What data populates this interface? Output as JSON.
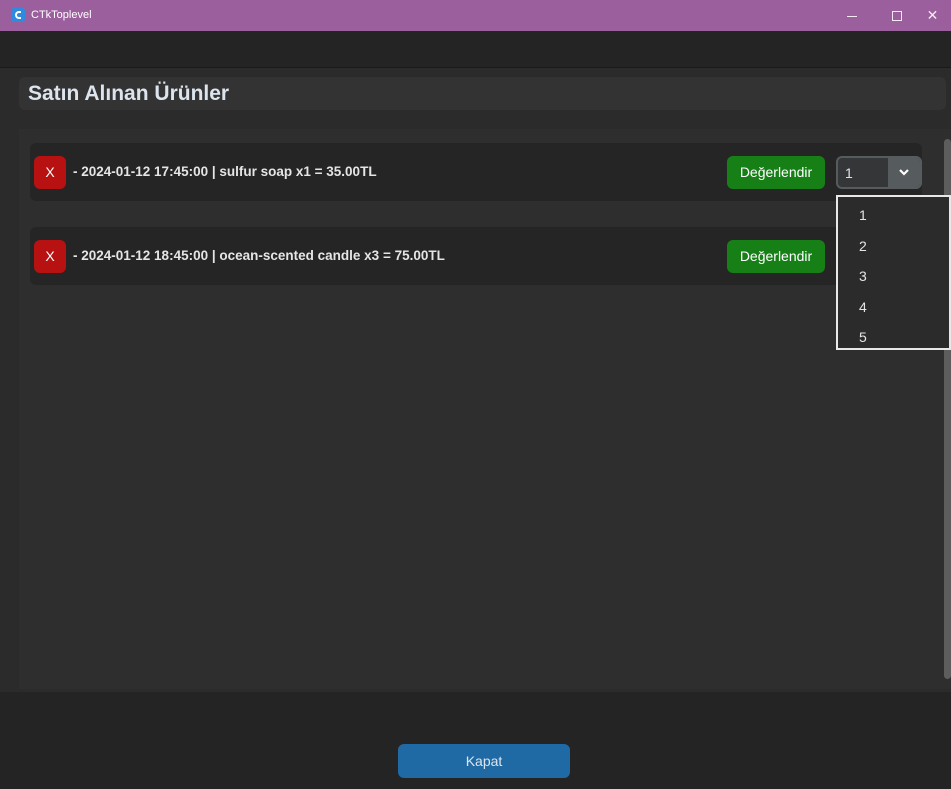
{
  "window": {
    "title": "CTkToplevel",
    "minimize_glyph": "minimize-icon",
    "maximize_glyph": "maximize-icon",
    "close_label": "✕"
  },
  "header": {
    "title": "Satın Alınan Ürünler"
  },
  "orders": [
    {
      "delete_label": "X",
      "text": "- 2024-01-12 17:45:00 | sulfur soap x1 = 35.00TL",
      "rate_label": "Değerlendir",
      "rating_value": "1"
    },
    {
      "delete_label": "X",
      "text": "- 2024-01-12 18:45:00 | ocean-scented candle x3 = 75.00TL",
      "rate_label": "Değerlendir"
    }
  ],
  "rating_options": [
    "1",
    "2",
    "3",
    "4",
    "5"
  ],
  "footer": {
    "close_label": "Kapat"
  },
  "colors": {
    "titlebar": "#9c5f9d",
    "delete": "#b71111",
    "rate": "#168016",
    "primary": "#1f6aa5"
  },
  "icons": {
    "app": "app-icon",
    "dropdown_arrow": "chevron-down-icon"
  }
}
